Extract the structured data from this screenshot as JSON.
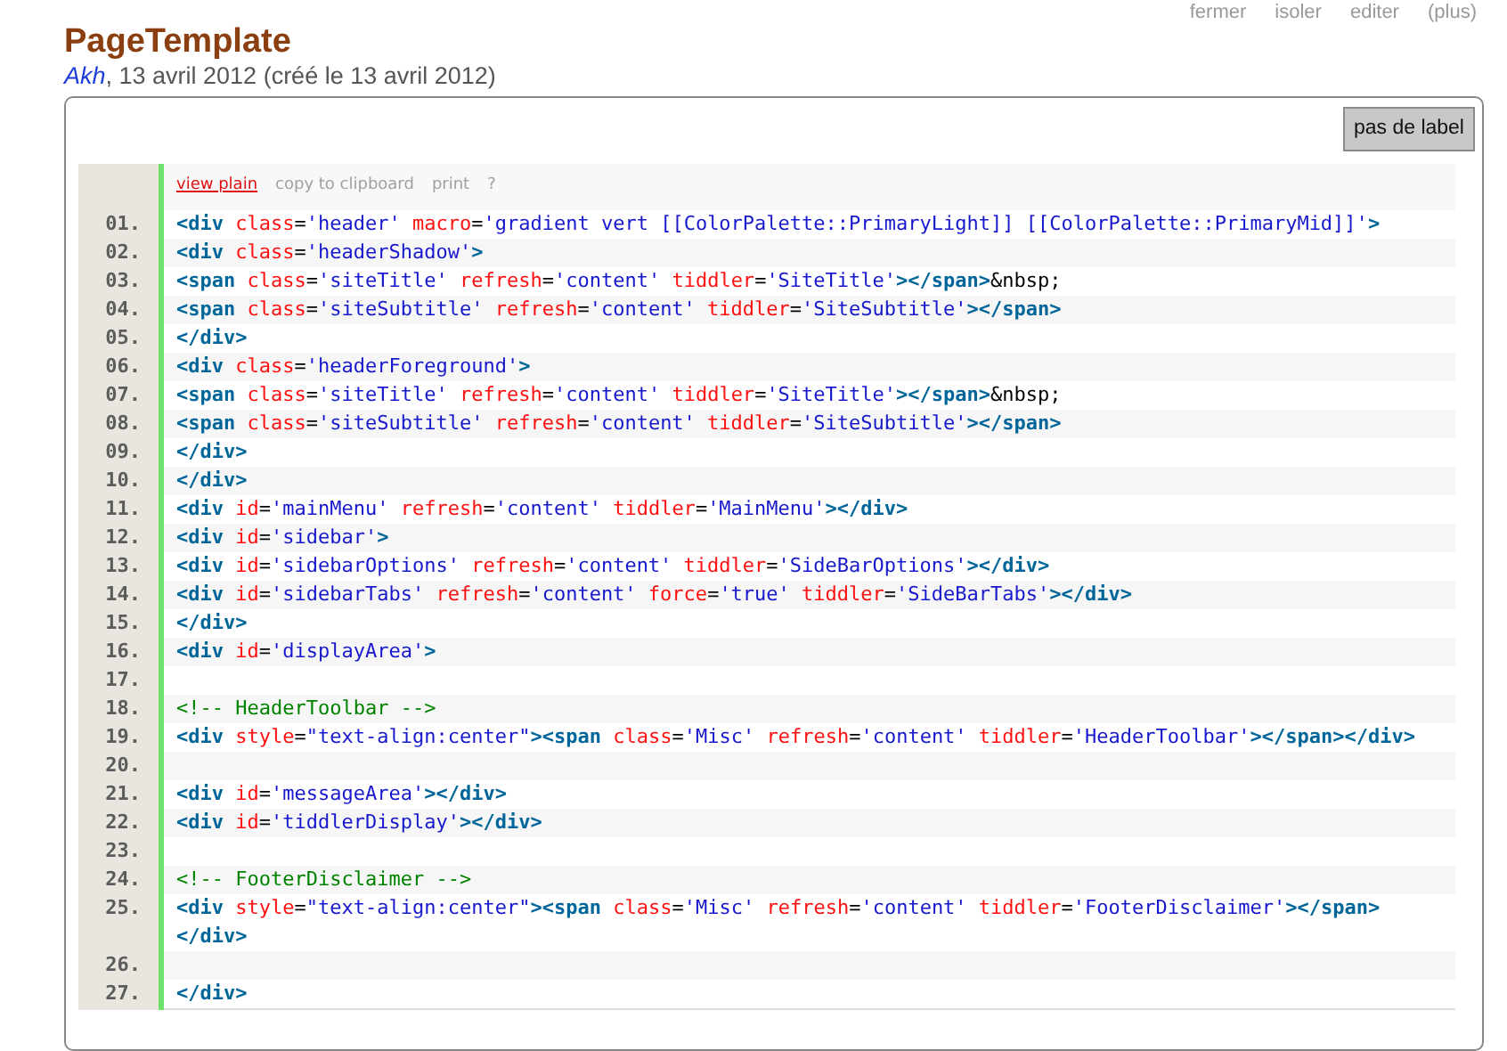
{
  "tiddler_toolbar": [
    "fermer",
    "isoler",
    "editer",
    "(plus)"
  ],
  "title": "PageTemplate",
  "subtitle": {
    "author": "Akh",
    "text": ", 13 avril 2012 (créé le 13 avril 2012)"
  },
  "label_button": "pas de label",
  "code_toolbar": [
    {
      "label": "view plain",
      "kind": "active"
    },
    {
      "label": "copy to clipboard",
      "kind": "plain"
    },
    {
      "label": "print",
      "kind": "plain"
    },
    {
      "label": "?",
      "kind": "plain"
    }
  ],
  "code_lines": [
    {
      "number": "01.",
      "tokens": [
        {
          "kind": "tag",
          "text": "<div"
        },
        {
          "kind": "attr",
          "text": " class"
        },
        {
          "kind": "plain",
          "text": "="
        },
        {
          "kind": "value",
          "text": "'header'"
        },
        {
          "kind": "attr",
          "text": " macro"
        },
        {
          "kind": "plain",
          "text": "="
        },
        {
          "kind": "value",
          "text": "'gradient vert [[ColorPalette::PrimaryLight]] [[ColorPalette::PrimaryMid]]'"
        },
        {
          "kind": "tag",
          "text": ">"
        }
      ]
    },
    {
      "number": "02.",
      "tokens": [
        {
          "kind": "tag",
          "text": "<div"
        },
        {
          "kind": "attr",
          "text": " class"
        },
        {
          "kind": "plain",
          "text": "="
        },
        {
          "kind": "value",
          "text": "'headerShadow'"
        },
        {
          "kind": "tag",
          "text": ">"
        }
      ]
    },
    {
      "number": "03.",
      "tokens": [
        {
          "kind": "tag",
          "text": "<span"
        },
        {
          "kind": "attr",
          "text": " class"
        },
        {
          "kind": "plain",
          "text": "="
        },
        {
          "kind": "value",
          "text": "'siteTitle'"
        },
        {
          "kind": "attr",
          "text": " refresh"
        },
        {
          "kind": "plain",
          "text": "="
        },
        {
          "kind": "value",
          "text": "'content'"
        },
        {
          "kind": "attr",
          "text": " tiddler"
        },
        {
          "kind": "plain",
          "text": "="
        },
        {
          "kind": "value",
          "text": "'SiteTitle'"
        },
        {
          "kind": "tag",
          "text": "></span>"
        },
        {
          "kind": "plain",
          "text": "&nbsp;"
        }
      ]
    },
    {
      "number": "04.",
      "tokens": [
        {
          "kind": "tag",
          "text": "<span"
        },
        {
          "kind": "attr",
          "text": " class"
        },
        {
          "kind": "plain",
          "text": "="
        },
        {
          "kind": "value",
          "text": "'siteSubtitle'"
        },
        {
          "kind": "attr",
          "text": " refresh"
        },
        {
          "kind": "plain",
          "text": "="
        },
        {
          "kind": "value",
          "text": "'content'"
        },
        {
          "kind": "attr",
          "text": " tiddler"
        },
        {
          "kind": "plain",
          "text": "="
        },
        {
          "kind": "value",
          "text": "'SiteSubtitle'"
        },
        {
          "kind": "tag",
          "text": "></span>"
        }
      ]
    },
    {
      "number": "05.",
      "tokens": [
        {
          "kind": "tag",
          "text": "</div>"
        }
      ]
    },
    {
      "number": "06.",
      "tokens": [
        {
          "kind": "tag",
          "text": "<div"
        },
        {
          "kind": "attr",
          "text": " class"
        },
        {
          "kind": "plain",
          "text": "="
        },
        {
          "kind": "value",
          "text": "'headerForeground'"
        },
        {
          "kind": "tag",
          "text": ">"
        }
      ]
    },
    {
      "number": "07.",
      "tokens": [
        {
          "kind": "tag",
          "text": "<span"
        },
        {
          "kind": "attr",
          "text": " class"
        },
        {
          "kind": "plain",
          "text": "="
        },
        {
          "kind": "value",
          "text": "'siteTitle'"
        },
        {
          "kind": "attr",
          "text": " refresh"
        },
        {
          "kind": "plain",
          "text": "="
        },
        {
          "kind": "value",
          "text": "'content'"
        },
        {
          "kind": "attr",
          "text": " tiddler"
        },
        {
          "kind": "plain",
          "text": "="
        },
        {
          "kind": "value",
          "text": "'SiteTitle'"
        },
        {
          "kind": "tag",
          "text": "></span>"
        },
        {
          "kind": "plain",
          "text": "&nbsp;"
        }
      ]
    },
    {
      "number": "08.",
      "tokens": [
        {
          "kind": "tag",
          "text": "<span"
        },
        {
          "kind": "attr",
          "text": " class"
        },
        {
          "kind": "plain",
          "text": "="
        },
        {
          "kind": "value",
          "text": "'siteSubtitle'"
        },
        {
          "kind": "attr",
          "text": " refresh"
        },
        {
          "kind": "plain",
          "text": "="
        },
        {
          "kind": "value",
          "text": "'content'"
        },
        {
          "kind": "attr",
          "text": " tiddler"
        },
        {
          "kind": "plain",
          "text": "="
        },
        {
          "kind": "value",
          "text": "'SiteSubtitle'"
        },
        {
          "kind": "tag",
          "text": "></span>"
        }
      ]
    },
    {
      "number": "09.",
      "tokens": [
        {
          "kind": "tag",
          "text": "</div>"
        }
      ]
    },
    {
      "number": "10.",
      "tokens": [
        {
          "kind": "tag",
          "text": "</div>"
        }
      ]
    },
    {
      "number": "11.",
      "tokens": [
        {
          "kind": "tag",
          "text": "<div"
        },
        {
          "kind": "attr",
          "text": " id"
        },
        {
          "kind": "plain",
          "text": "="
        },
        {
          "kind": "value",
          "text": "'mainMenu'"
        },
        {
          "kind": "attr",
          "text": " refresh"
        },
        {
          "kind": "plain",
          "text": "="
        },
        {
          "kind": "value",
          "text": "'content'"
        },
        {
          "kind": "attr",
          "text": " tiddler"
        },
        {
          "kind": "plain",
          "text": "="
        },
        {
          "kind": "value",
          "text": "'MainMenu'"
        },
        {
          "kind": "tag",
          "text": "></div>"
        }
      ]
    },
    {
      "number": "12.",
      "tokens": [
        {
          "kind": "tag",
          "text": "<div"
        },
        {
          "kind": "attr",
          "text": " id"
        },
        {
          "kind": "plain",
          "text": "="
        },
        {
          "kind": "value",
          "text": "'sidebar'"
        },
        {
          "kind": "tag",
          "text": ">"
        }
      ]
    },
    {
      "number": "13.",
      "tokens": [
        {
          "kind": "tag",
          "text": "<div"
        },
        {
          "kind": "attr",
          "text": " id"
        },
        {
          "kind": "plain",
          "text": "="
        },
        {
          "kind": "value",
          "text": "'sidebarOptions'"
        },
        {
          "kind": "attr",
          "text": " refresh"
        },
        {
          "kind": "plain",
          "text": "="
        },
        {
          "kind": "value",
          "text": "'content'"
        },
        {
          "kind": "attr",
          "text": " tiddler"
        },
        {
          "kind": "plain",
          "text": "="
        },
        {
          "kind": "value",
          "text": "'SideBarOptions'"
        },
        {
          "kind": "tag",
          "text": "></div>"
        }
      ]
    },
    {
      "number": "14.",
      "tokens": [
        {
          "kind": "tag",
          "text": "<div"
        },
        {
          "kind": "attr",
          "text": " id"
        },
        {
          "kind": "plain",
          "text": "="
        },
        {
          "kind": "value",
          "text": "'sidebarTabs'"
        },
        {
          "kind": "attr",
          "text": " refresh"
        },
        {
          "kind": "plain",
          "text": "="
        },
        {
          "kind": "value",
          "text": "'content'"
        },
        {
          "kind": "attr",
          "text": " force"
        },
        {
          "kind": "plain",
          "text": "="
        },
        {
          "kind": "value",
          "text": "'true'"
        },
        {
          "kind": "attr",
          "text": " tiddler"
        },
        {
          "kind": "plain",
          "text": "="
        },
        {
          "kind": "value",
          "text": "'SideBarTabs'"
        },
        {
          "kind": "tag",
          "text": "></div>"
        }
      ]
    },
    {
      "number": "15.",
      "tokens": [
        {
          "kind": "tag",
          "text": "</div>"
        }
      ]
    },
    {
      "number": "16.",
      "tokens": [
        {
          "kind": "tag",
          "text": "<div"
        },
        {
          "kind": "attr",
          "text": " id"
        },
        {
          "kind": "plain",
          "text": "="
        },
        {
          "kind": "value",
          "text": "'displayArea'"
        },
        {
          "kind": "tag",
          "text": ">"
        }
      ]
    },
    {
      "number": "17."
    },
    {
      "number": "18.",
      "tokens": [
        {
          "kind": "comment",
          "text": "<!-- HeaderToolbar -->"
        }
      ]
    },
    {
      "number": "19.",
      "tokens": [
        {
          "kind": "tag",
          "text": "<div"
        },
        {
          "kind": "attr",
          "text": " style"
        },
        {
          "kind": "plain",
          "text": "="
        },
        {
          "kind": "value",
          "text": "\"text-align:center\""
        },
        {
          "kind": "tag",
          "text": "><span"
        },
        {
          "kind": "attr",
          "text": " class"
        },
        {
          "kind": "plain",
          "text": "="
        },
        {
          "kind": "value",
          "text": "'Misc'"
        },
        {
          "kind": "attr",
          "text": " refresh"
        },
        {
          "kind": "plain",
          "text": "="
        },
        {
          "kind": "value",
          "text": "'content'"
        },
        {
          "kind": "attr",
          "text": " tiddler"
        },
        {
          "kind": "plain",
          "text": "="
        },
        {
          "kind": "value",
          "text": "'HeaderToolbar'"
        },
        {
          "kind": "tag",
          "text": "></span>"
        },
        {
          "kind": "tag",
          "text": "</div>"
        }
      ]
    },
    {
      "number": "20."
    },
    {
      "number": "21.",
      "tokens": [
        {
          "kind": "tag",
          "text": "<div"
        },
        {
          "kind": "attr",
          "text": " id"
        },
        {
          "kind": "plain",
          "text": "="
        },
        {
          "kind": "value",
          "text": "'messageArea'"
        },
        {
          "kind": "tag",
          "text": "></div>"
        }
      ]
    },
    {
      "number": "22.",
      "tokens": [
        {
          "kind": "tag",
          "text": "<div"
        },
        {
          "kind": "attr",
          "text": " id"
        },
        {
          "kind": "plain",
          "text": "="
        },
        {
          "kind": "value",
          "text": "'tiddlerDisplay'"
        },
        {
          "kind": "tag",
          "text": "></div>"
        }
      ]
    },
    {
      "number": "23."
    },
    {
      "number": "24.",
      "tokens": [
        {
          "kind": "comment",
          "text": "<!-- FooterDisclaimer -->"
        }
      ]
    },
    {
      "number": "25.",
      "tokens": [
        {
          "kind": "tag",
          "text": "<div"
        },
        {
          "kind": "attr",
          "text": " style"
        },
        {
          "kind": "plain",
          "text": "="
        },
        {
          "kind": "value",
          "text": "\"text-align:center\""
        },
        {
          "kind": "tag",
          "text": "><span"
        },
        {
          "kind": "attr",
          "text": " class"
        },
        {
          "kind": "plain",
          "text": "="
        },
        {
          "kind": "value",
          "text": "'Misc'"
        },
        {
          "kind": "attr",
          "text": " refresh"
        },
        {
          "kind": "plain",
          "text": "="
        },
        {
          "kind": "value",
          "text": "'content'"
        },
        {
          "kind": "attr",
          "text": " tiddler"
        },
        {
          "kind": "plain",
          "text": "="
        },
        {
          "kind": "value",
          "text": "'FooterDisclaimer'"
        },
        {
          "kind": "tag",
          "text": "></span>"
        },
        {
          "kind": "tag",
          "text": "</div>"
        }
      ]
    },
    {
      "number": "26."
    },
    {
      "number": "27.",
      "tokens": [
        {
          "kind": "tag",
          "text": "</div>"
        }
      ]
    }
  ]
}
